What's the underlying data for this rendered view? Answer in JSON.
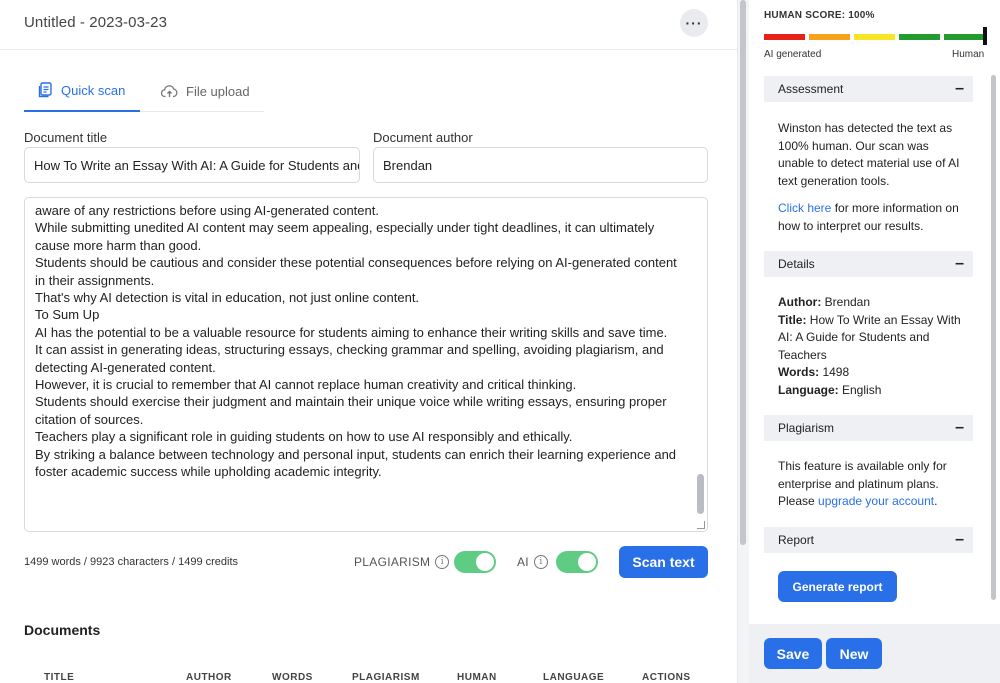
{
  "header": {
    "doc_name": "Untitled - 2023-03-23",
    "more_label": "···"
  },
  "tabs": [
    {
      "label": "Quick scan",
      "icon": "document-icon",
      "active": true
    },
    {
      "label": "File upload",
      "icon": "cloud-upload-icon",
      "active": false
    }
  ],
  "form": {
    "title_label": "Document title",
    "title_value": "How To Write an Essay With AI: A Guide for Students and",
    "author_label": "Document author",
    "author_value": "Brendan"
  },
  "editor_lines": [
    "aware of any restrictions before using AI-generated content.",
    "While submitting unedited AI content may seem appealing, especially under tight deadlines, it can ultimately cause more harm than good.",
    "Students should be cautious and consider these potential consequences before relying on AI-generated content in their assignments.",
    "That's why AI detection is vital in education, not just online content.",
    "To Sum Up",
    "AI has the potential to be a valuable resource for students aiming to enhance their writing skills and save time.",
    "It can assist in generating ideas, structuring essays, checking grammar and spelling, avoiding plagiarism, and detecting AI-generated content.",
    "However, it is crucial to remember that AI cannot replace human creativity and critical thinking.",
    "Students should exercise their judgment and maintain their unique voice while writing essays, ensuring proper citation of sources.",
    "Teachers play a significant role in guiding students on how to use AI responsibly and ethically.",
    "By striking a balance between technology and personal input, students can enrich their learning experience and foster academic success while upholding academic integrity."
  ],
  "scan_bar": {
    "counts": "1499 words / 9923 characters / 1499 credits",
    "plagiarism_label": "PLAGIARISM",
    "plagiarism_on": true,
    "ai_label": "AI",
    "ai_on": true,
    "scan_button": "Scan text",
    "toggle_color": "#5fcc84"
  },
  "documents": {
    "title": "Documents",
    "columns": [
      "TITLE",
      "AUTHOR",
      "WORDS",
      "PLAGIARISM",
      "HUMAN",
      "LANGUAGE",
      "ACTIONS"
    ]
  },
  "score": {
    "label": "HUMAN SCORE: 100%",
    "value_percent": 100,
    "low_label": "AI generated",
    "high_label": "Human",
    "segments": [
      "#e8201a",
      "#f7a21b",
      "#f5e626",
      "#239b2e",
      "#239b2e"
    ]
  },
  "assessment": {
    "title": "Assessment",
    "text": "Winston has detected the text as 100% human. Our scan was unable to detect material use of AI text generation tools.",
    "link": "Click here",
    "link_after": " for more information on how to interpret our results."
  },
  "details": {
    "title": "Details",
    "author_key": "Author:",
    "author": " Brendan",
    "title_key": "Title:",
    "title_value": " How To Write an Essay With AI: A Guide for Students and Teachers",
    "words_key": "Words:",
    "words": " 1498",
    "language_key": "Language:",
    "language": " English"
  },
  "plagiarism": {
    "title": "Plagiarism",
    "text": "This feature is available only for enterprise and platinum plans. Please ",
    "link": "upgrade your account",
    "after": "."
  },
  "report": {
    "title": "Report",
    "button": "Generate report"
  },
  "footer": {
    "save": "Save",
    "new": "New"
  },
  "colors": {
    "accent": "#2970e8",
    "panel_bg": "#eef0f3"
  }
}
